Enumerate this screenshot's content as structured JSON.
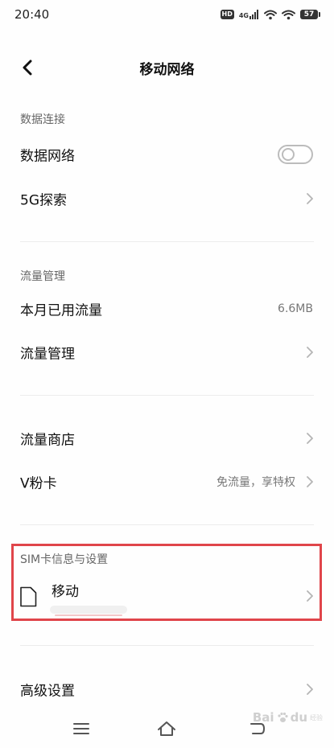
{
  "status": {
    "time": "20:40",
    "hd_label": "HD",
    "network_label": "4G",
    "battery": "57"
  },
  "nav": {
    "title": "移动网络",
    "back_icon": "chevron-left-icon"
  },
  "sections": {
    "data_connection": {
      "header": "数据连接",
      "data_network": {
        "label": "数据网络",
        "enabled": false
      },
      "explore_5g": {
        "label": "5G探索"
      }
    },
    "traffic": {
      "header": "流量管理",
      "monthly_usage": {
        "label": "本月已用流量",
        "value": "6.6MB"
      },
      "traffic_management": {
        "label": "流量管理"
      }
    },
    "store": {
      "traffic_store": {
        "label": "流量商店"
      },
      "v_card": {
        "label": "V粉卡",
        "value": "免流量，享特权"
      }
    },
    "sim": {
      "header": "SIM卡信息与设置",
      "card": {
        "name": "移动",
        "icon": "sim-card-icon"
      }
    },
    "advanced": {
      "settings": {
        "label": "高级设置"
      }
    }
  },
  "bottom_nav": {
    "icons": [
      "menu-icon",
      "home-icon",
      "back-icon"
    ]
  },
  "watermark": {
    "text": "Bai",
    "suffix": "du",
    "sub": "经验"
  },
  "colors": {
    "highlight": "#e0454a",
    "text_primary": "#111111",
    "text_secondary": "#777777",
    "section_header": "#666666"
  }
}
